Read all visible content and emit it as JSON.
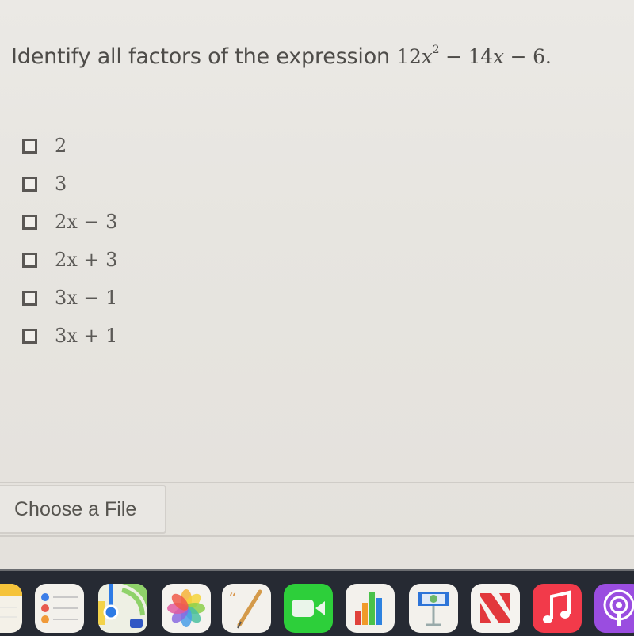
{
  "question": {
    "prefix": "Identify all factors of the expression ",
    "expr_coef1": "12",
    "expr_var1": "x",
    "expr_exp": "2",
    "expr_rest1": " − 14",
    "expr_var2": "x",
    "expr_rest2": " − 6."
  },
  "options": [
    {
      "label": "2",
      "checked": false
    },
    {
      "label": "3",
      "checked": false
    },
    {
      "label": "2x − 3",
      "checked": false
    },
    {
      "label": "2x + 3",
      "checked": false
    },
    {
      "label": "3x − 1",
      "checked": false
    },
    {
      "label": "3x + 1",
      "checked": false
    }
  ],
  "file_upload": {
    "button_label": "Choose a File"
  },
  "dock": {
    "apps": [
      {
        "name": "notes",
        "icon": "notes-icon"
      },
      {
        "name": "reminders",
        "icon": "reminders-icon"
      },
      {
        "name": "maps",
        "icon": "maps-icon"
      },
      {
        "name": "photos",
        "icon": "photos-icon"
      },
      {
        "name": "pages",
        "icon": "pages-icon"
      },
      {
        "name": "facetime",
        "icon": "facetime-icon"
      },
      {
        "name": "numbers",
        "icon": "numbers-icon"
      },
      {
        "name": "keynote",
        "icon": "keynote-icon"
      },
      {
        "name": "news",
        "icon": "news-icon"
      },
      {
        "name": "music",
        "icon": "music-icon"
      },
      {
        "name": "podcasts",
        "icon": "podcasts-icon"
      }
    ]
  }
}
